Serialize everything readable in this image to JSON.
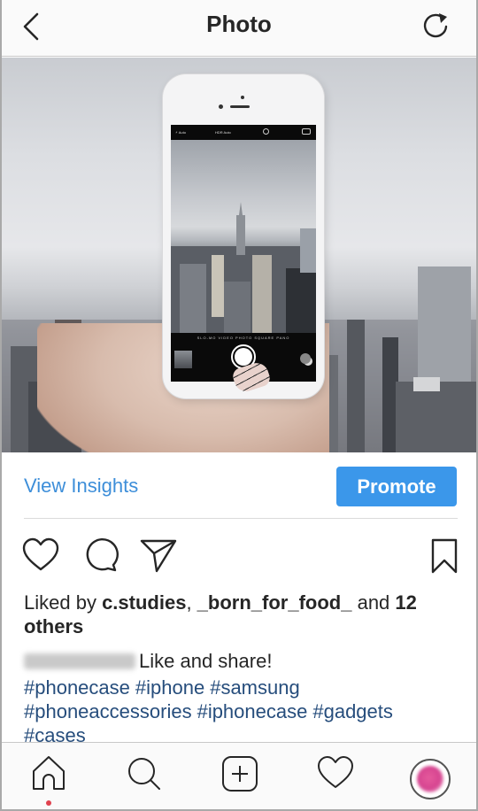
{
  "header": {
    "title": "Photo",
    "back_icon": "chevron-left-icon",
    "refresh_icon": "refresh-icon"
  },
  "photo": {
    "description": "Hand holding a white smartphone photographing a city skyline",
    "camera_ui": {
      "flash": "⚡ Auto",
      "hdr": "HDR Auto",
      "modes": "SLO-MO  VIDEO  PHOTO  SQUARE  PANO"
    }
  },
  "insights": {
    "view_label": "View Insights",
    "promote_label": "Promote"
  },
  "actions": {
    "like_icon": "heart-icon",
    "comment_icon": "comment-icon",
    "share_icon": "send-icon",
    "save_icon": "bookmark-icon"
  },
  "likes": {
    "prefix": "Liked by ",
    "user1": "c.studies",
    "separator": ", ",
    "user2": "_born_for_food_",
    "middle": " and ",
    "others": "12 others"
  },
  "caption": {
    "username": "cases_dom",
    "text": "Like and share!",
    "hashtags": [
      "#phonecase",
      "#iphone",
      "#samsung",
      "#phoneaccessories",
      "#iphonecase",
      "#gadgets",
      "#cases"
    ]
  },
  "tabbar": {
    "items": [
      {
        "name": "home",
        "icon": "home-icon",
        "active": true
      },
      {
        "name": "search",
        "icon": "search-icon"
      },
      {
        "name": "new-post",
        "icon": "plus-square-icon"
      },
      {
        "name": "activity",
        "icon": "heart-icon"
      },
      {
        "name": "profile",
        "icon": "avatar"
      }
    ],
    "notification_color": "#e0424e"
  },
  "colors": {
    "link_blue": "#3d8ed9",
    "button_blue": "#3b97ea",
    "hashtag": "#264d7c"
  }
}
